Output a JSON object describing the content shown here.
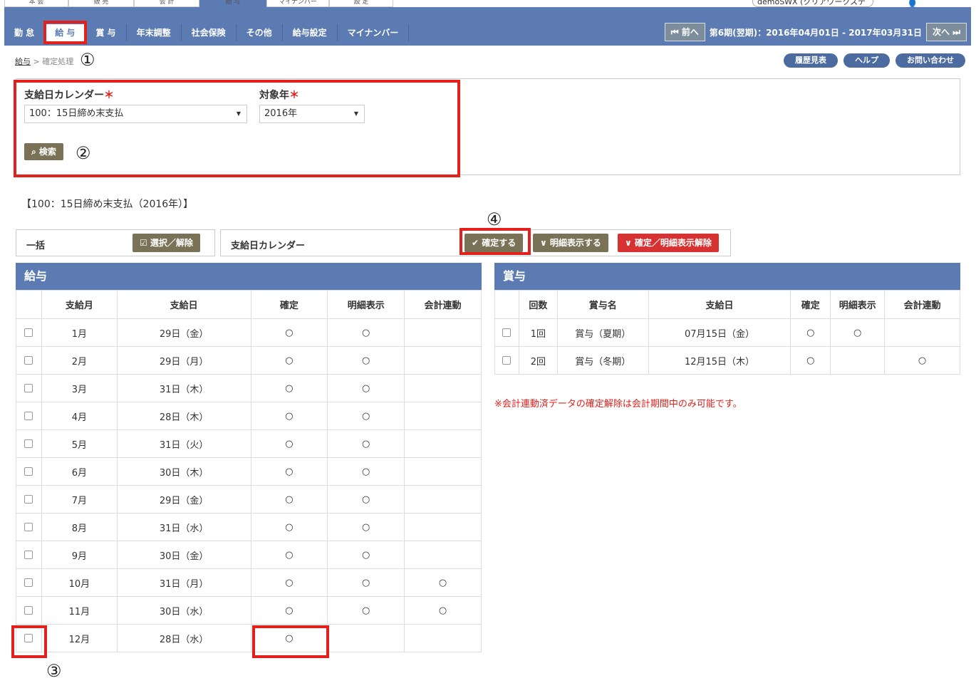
{
  "top_tabs": [
    "本 会",
    "販 売",
    "会 計",
    "給 与",
    "マイナンバー",
    "設 定"
  ],
  "user": {
    "name": "demoSWX (クリアワークステ 環境)",
    "logout": "ログアウト"
  },
  "nav": {
    "items": [
      "勤 怠",
      "給 与",
      "賞 与",
      "年末調整",
      "社会保険",
      "その他",
      "給与設定",
      "マイナンバー"
    ],
    "active_index": 1,
    "prev_label": "⏮ 前へ",
    "period_text": "第6期(翌期)：2016年04月01日 - 2017年03月31日",
    "next_label": "次へ ⏭"
  },
  "breadcrumb": {
    "root": "給与",
    "separator": ">",
    "current": "確定処理"
  },
  "header_links": [
    "履歴見表",
    "ヘルプ",
    "お問い合わせ"
  ],
  "search": {
    "calendar_label": "支給日カレンダー",
    "calendar_value": "100：15日締め末支払",
    "year_label": "対象年",
    "year_value": "2016年",
    "required_mark": "＊",
    "search_button": "⌕ 検索"
  },
  "section_title": "【100：15日締め末支払（2016年）】",
  "actions": {
    "bulk_label": "一括",
    "select_toggle": "☑ 選択／解除",
    "calendar_label": "支給日カレンダー",
    "confirm": "✔ 確定する",
    "show_detail": "∨ 明細表示する",
    "cancel": "∨ 確定／明細表示解除"
  },
  "salary": {
    "title": "給与",
    "columns": [
      "",
      "支給月",
      "支給日",
      "確定",
      "明細表示",
      "会計連動"
    ],
    "rows": [
      {
        "month": "1月",
        "date": "29日（金）",
        "confirmed": "○",
        "detail": "○",
        "linked": ""
      },
      {
        "month": "2月",
        "date": "29日（月）",
        "confirmed": "○",
        "detail": "○",
        "linked": ""
      },
      {
        "month": "3月",
        "date": "31日（木）",
        "confirmed": "○",
        "detail": "○",
        "linked": ""
      },
      {
        "month": "4月",
        "date": "28日（木）",
        "confirmed": "○",
        "detail": "○",
        "linked": ""
      },
      {
        "month": "5月",
        "date": "31日（火）",
        "confirmed": "○",
        "detail": "○",
        "linked": ""
      },
      {
        "month": "6月",
        "date": "30日（木）",
        "confirmed": "○",
        "detail": "○",
        "linked": ""
      },
      {
        "month": "7月",
        "date": "29日（金）",
        "confirmed": "○",
        "detail": "○",
        "linked": ""
      },
      {
        "month": "8月",
        "date": "31日（水）",
        "confirmed": "○",
        "detail": "○",
        "linked": ""
      },
      {
        "month": "9月",
        "date": "30日（金）",
        "confirmed": "○",
        "detail": "○",
        "linked": ""
      },
      {
        "month": "10月",
        "date": "31日（月）",
        "confirmed": "○",
        "detail": "○",
        "linked": "○"
      },
      {
        "month": "11月",
        "date": "30日（水）",
        "confirmed": "○",
        "detail": "○",
        "linked": "○"
      },
      {
        "month": "12月",
        "date": "28日（水）",
        "confirmed": "○",
        "detail": "",
        "linked": ""
      }
    ]
  },
  "bonus": {
    "title": "賞与",
    "columns": [
      "",
      "回数",
      "賞与名",
      "支給日",
      "確定",
      "明細表示",
      "会計連動"
    ],
    "rows": [
      {
        "count": "1回",
        "name": "賞与（夏期）",
        "date": "07月15日（金）",
        "confirmed": "○",
        "detail": "○",
        "linked": ""
      },
      {
        "count": "2回",
        "name": "賞与（冬期）",
        "date": "12月15日（木）",
        "confirmed": "○",
        "detail": "",
        "linked": "○"
      }
    ]
  },
  "note": "※会計連動済データの確定解除は会計期間中のみ可能です。",
  "annotations": [
    "①",
    "②",
    "③",
    "④"
  ],
  "colors": {
    "nav": "#5b7bb2",
    "highlight": "#e2211c",
    "olive_button": "#7a7256",
    "red_button": "#d63232"
  }
}
